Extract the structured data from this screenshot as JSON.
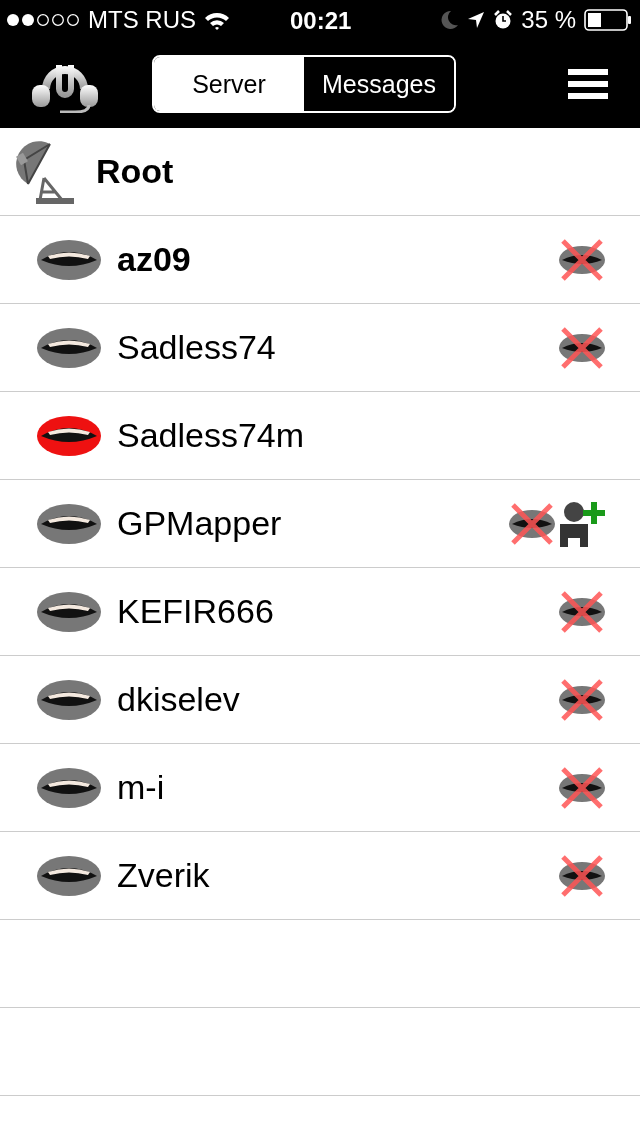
{
  "status_bar": {
    "carrier": "MTS RUS",
    "time": "00:21",
    "battery_text": "35 %"
  },
  "tabs": [
    {
      "label": "Server",
      "selected": true
    },
    {
      "label": "Messages",
      "selected": false
    }
  ],
  "channel": {
    "name": "Root"
  },
  "users": [
    {
      "name": "az09",
      "is_self": true,
      "talking": false,
      "muted": true,
      "register_badge": false
    },
    {
      "name": "Sadless74",
      "is_self": false,
      "talking": false,
      "muted": true,
      "register_badge": false
    },
    {
      "name": "Sadless74m",
      "is_self": false,
      "talking": true,
      "muted": false,
      "register_badge": false
    },
    {
      "name": "GPMapper",
      "is_self": false,
      "talking": false,
      "muted": true,
      "register_badge": true
    },
    {
      "name": "KEFIR666",
      "is_self": false,
      "talking": false,
      "muted": true,
      "register_badge": false
    },
    {
      "name": "dkiselev",
      "is_self": false,
      "talking": false,
      "muted": true,
      "register_badge": false
    },
    {
      "name": "m-i",
      "is_self": false,
      "talking": false,
      "muted": true,
      "register_badge": false
    },
    {
      "name": "Zverik",
      "is_self": false,
      "talking": false,
      "muted": true,
      "register_badge": false
    }
  ]
}
